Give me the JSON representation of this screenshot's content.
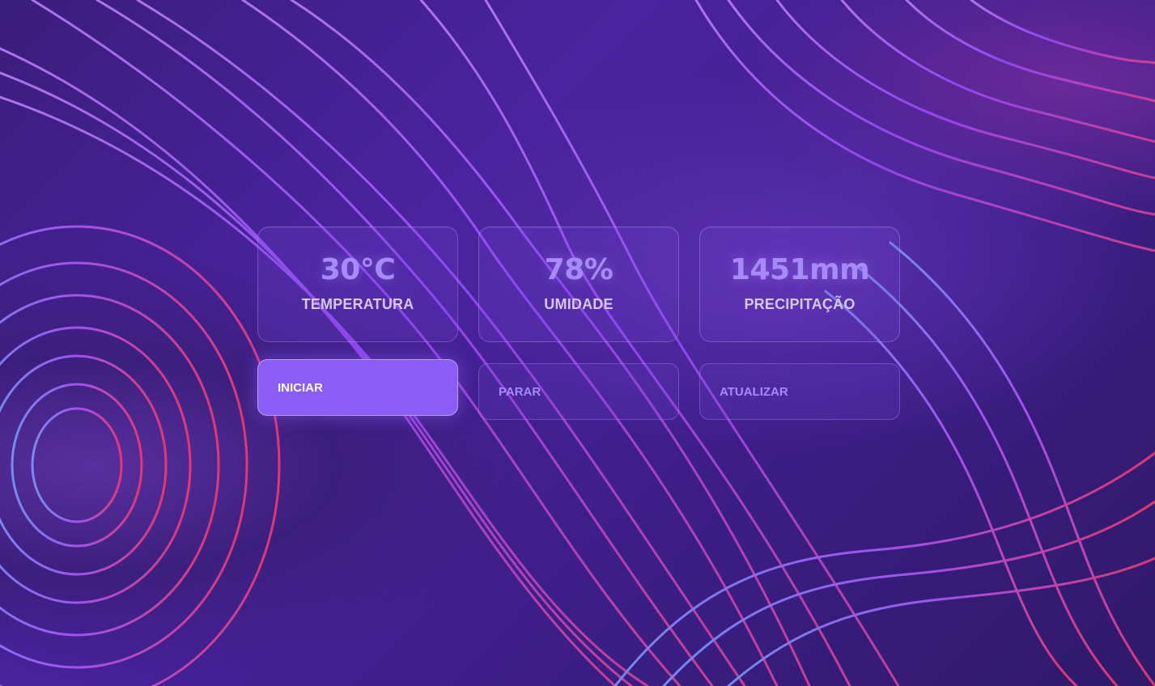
{
  "metrics": [
    {
      "value": "30°C",
      "label": "TEMPERATURA"
    },
    {
      "value": "78%",
      "label": "UMIDADE"
    },
    {
      "value": "1451mm",
      "label": "PRECIPITAÇÃO"
    }
  ],
  "actions": {
    "start_label": "INICIAR",
    "stop_label": "PARAR",
    "refresh_label": "ATUALIZAR"
  },
  "colors": {
    "accent": "#8b5cf6",
    "value_text": "#a78bfa",
    "label_text": "#d6c8f2",
    "background": "#3a1e7c"
  },
  "icons": [
    "abstract-wave-background"
  ]
}
